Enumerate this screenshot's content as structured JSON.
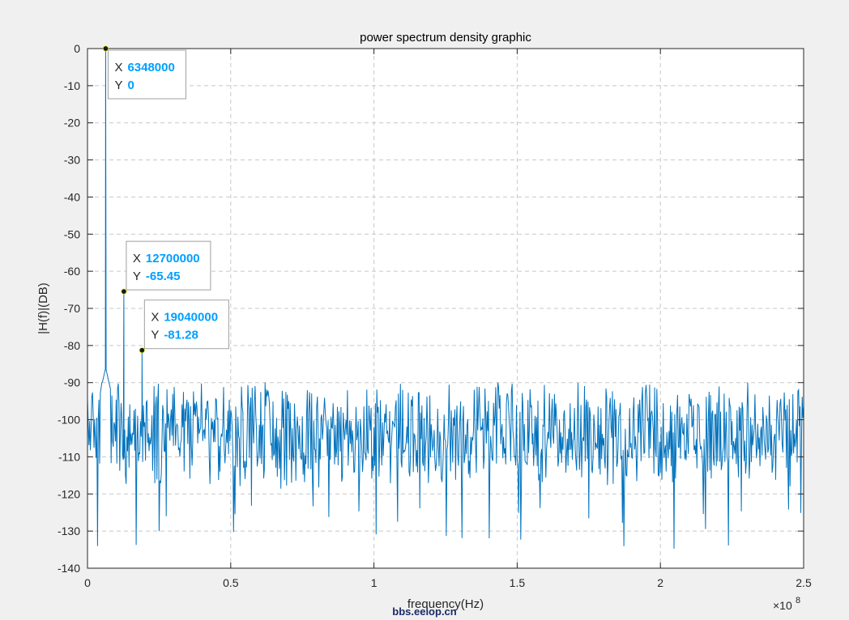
{
  "chart_data": {
    "type": "line",
    "title": "power spectrum density graphic",
    "xlabel": "frequency(Hz)",
    "ylabel": "|H(f)|(DB)",
    "x_exponent_label": "×10",
    "x_exponent_power": "8",
    "xlim": [
      0,
      250000000
    ],
    "ylim": [
      -140,
      0
    ],
    "xticks": [
      0,
      50000000,
      100000000,
      150000000,
      200000000,
      250000000
    ],
    "xtick_labels": [
      "0",
      "0.5",
      "1",
      "1.5",
      "2",
      "2.5"
    ],
    "yticks": [
      0,
      -10,
      -20,
      -30,
      -40,
      -50,
      -60,
      -70,
      -80,
      -90,
      -100,
      -110,
      -120,
      -130,
      -140
    ],
    "ytick_labels": [
      "0",
      "-10",
      "-20",
      "-30",
      "-40",
      "-50",
      "-60",
      "-70",
      "-80",
      "-90",
      "-100",
      "-110",
      "-120",
      "-130",
      "-140"
    ],
    "grid": true,
    "line_color": "#0072bd",
    "noise_floor_mean": -104,
    "noise_floor_range": [
      -135,
      -90
    ],
    "peaks": [
      {
        "x": 6348000,
        "y": 0
      },
      {
        "x": 12700000,
        "y": -65.45
      },
      {
        "x": 19040000,
        "y": -81.28
      }
    ],
    "datatips": [
      {
        "x_key": "X",
        "x_value": "6348000",
        "y_key": "Y",
        "y_value": "0"
      },
      {
        "x_key": "X",
        "x_value": "12700000",
        "y_key": "Y",
        "y_value": "-65.45"
      },
      {
        "x_key": "X",
        "x_value": "19040000",
        "y_key": "Y",
        "y_value": "-81.28"
      }
    ]
  },
  "watermark": "bbs.eeiop.cn",
  "colors": {
    "figure_background": "#f0f0f0",
    "axes_background": "#ffffff",
    "datatip_value": "#00a0ff"
  }
}
